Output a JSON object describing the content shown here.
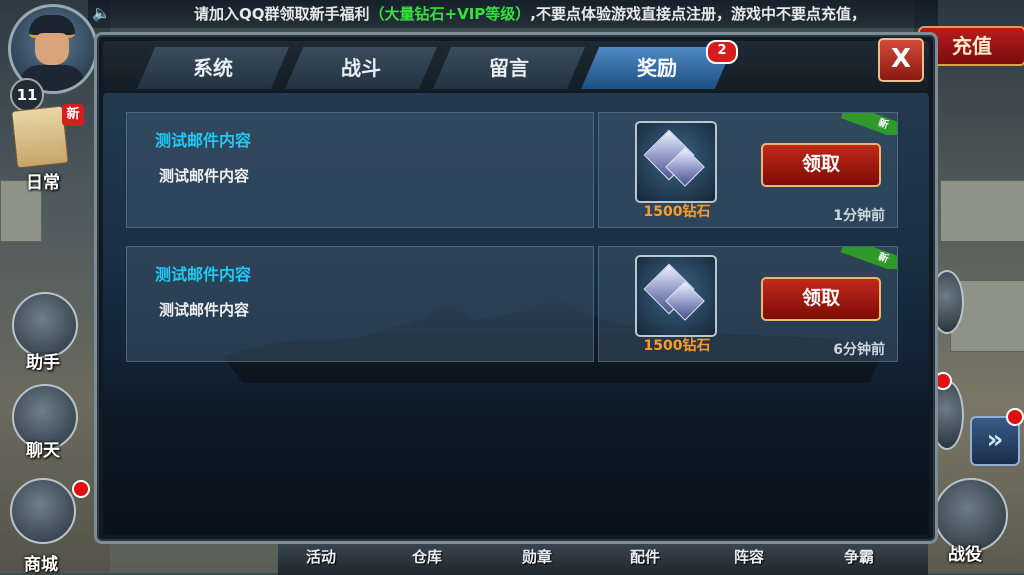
{
  "notice": {
    "text_prefix": "请加入QQ群领取新手福利",
    "text_highlight": "（大量钻石+VIP等级）",
    "text_suffix": ",不要点体验游戏直接点注册，游戏中不要点充值，"
  },
  "player": {
    "level": "11"
  },
  "recharge_label": "充值",
  "left_menu": {
    "daily_new_tag": "新",
    "daily_label": "日常",
    "helper_label": "助手",
    "chat_label": "聊天",
    "shop_label": "商城"
  },
  "tabs": [
    {
      "label": "系统",
      "active": false
    },
    {
      "label": "战斗",
      "active": false
    },
    {
      "label": "留言",
      "active": false
    },
    {
      "label": "奖励",
      "active": true,
      "badge": "2"
    }
  ],
  "close_label": "X",
  "mails": [
    {
      "title": "测试邮件内容",
      "body": "测试邮件内容",
      "reward": "1500钻石",
      "claim_label": "领取",
      "time": "1分钟前",
      "new_tag": "新"
    },
    {
      "title": "测试邮件内容",
      "body": "测试邮件内容",
      "reward": "1500钻石",
      "claim_label": "领取",
      "time": "6分钟前",
      "new_tag": "新"
    }
  ],
  "bottom_nav": [
    "活动",
    "仓库",
    "勋章",
    "配件",
    "阵容",
    "争霸"
  ],
  "battle_label": "战役",
  "colors": {
    "accent": "#22c8f5",
    "reward": "#ff9b2a",
    "highlight": "#37e13c",
    "badge": "#d71c1c"
  }
}
